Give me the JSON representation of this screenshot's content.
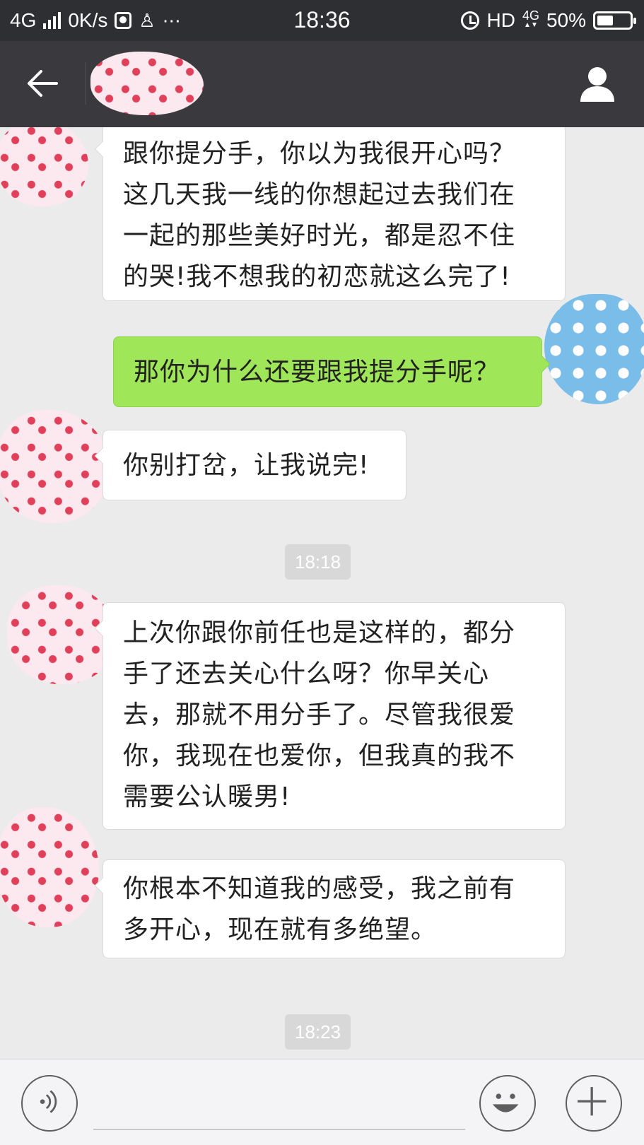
{
  "status_bar": {
    "network": "4G",
    "speed": "0K/s",
    "time": "18:36",
    "hd": "HD",
    "net_4g": "4G",
    "battery": "50%",
    "battery_level": 0.5
  },
  "header": {
    "back_icon": "back-arrow-icon",
    "profile_icon": "person-icon"
  },
  "messages": [
    {
      "side": "received",
      "text_lines": [
        "跟你提分手，你以为我很开心吗？",
        "这几天我一线的你想起过去我们在",
        "一起的那些美好时光，都是忍不住",
        "的哭!我不想我的初恋就这么完了!"
      ]
    },
    {
      "side": "sent",
      "text": "那你为什么还要跟我提分手呢？"
    },
    {
      "side": "received",
      "text": "你别打岔，让我说完!"
    },
    {
      "type": "timestamp",
      "text": "18:18"
    },
    {
      "side": "received",
      "text_lines": [
        "上次你跟你前任也是这样的，都分",
        "手了还去关心什么呀？你早关心",
        "去，那就不用分手了。尽管我很爱",
        "你，我现在也爱你，但我真的我不",
        "需要公认暖男!"
      ]
    },
    {
      "side": "received",
      "text_lines": [
        "你根本不知道我的感受，我之前有",
        "多开心，现在就有多绝望。"
      ]
    },
    {
      "type": "timestamp",
      "text": "18:23"
    }
  ],
  "input_bar": {
    "voice_icon": "voice-icon",
    "emoji_icon": "emoji-icon",
    "plus_icon": "plus-icon",
    "input_value": ""
  },
  "colors": {
    "status_bar": "#2e2f33",
    "header": "#3a3a3e",
    "background": "#ebebeb",
    "sent_bubble": "#9fe658",
    "received_bubble": "#ffffff"
  }
}
